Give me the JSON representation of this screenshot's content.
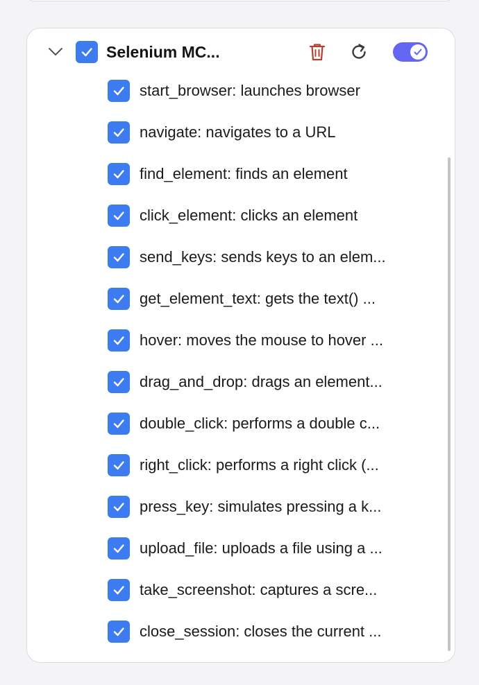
{
  "colors": {
    "accent_blue": "#3c7cf0",
    "toggle_indigo": "#6366f1",
    "trash_red": "#b4402e",
    "icon_dark": "#3a3a3a"
  },
  "server": {
    "name": "Selenium MC...",
    "enabled": true,
    "checked": true,
    "expanded": true,
    "icons": [
      "chevron-down-icon",
      "trash-icon",
      "refresh-icon",
      "toggle-switch"
    ]
  },
  "tools": [
    {
      "label": "start_browser: launches browser",
      "checked": true
    },
    {
      "label": "navigate: navigates to a URL",
      "checked": true
    },
    {
      "label": "find_element: finds an element",
      "checked": true
    },
    {
      "label": "click_element: clicks an element",
      "checked": true
    },
    {
      "label": "send_keys: sends keys to an elem...",
      "checked": true
    },
    {
      "label": "get_element_text: gets the text() ...",
      "checked": true
    },
    {
      "label": "hover: moves the mouse to hover ...",
      "checked": true
    },
    {
      "label": "drag_and_drop: drags an element...",
      "checked": true
    },
    {
      "label": "double_click: performs a double c...",
      "checked": true
    },
    {
      "label": "right_click: performs a right click (...",
      "checked": true
    },
    {
      "label": "press_key: simulates pressing a k...",
      "checked": true
    },
    {
      "label": "upload_file: uploads a file using a ...",
      "checked": true
    },
    {
      "label": "take_screenshot: captures a scre...",
      "checked": true
    },
    {
      "label": "close_session: closes the current ...",
      "checked": true
    }
  ]
}
